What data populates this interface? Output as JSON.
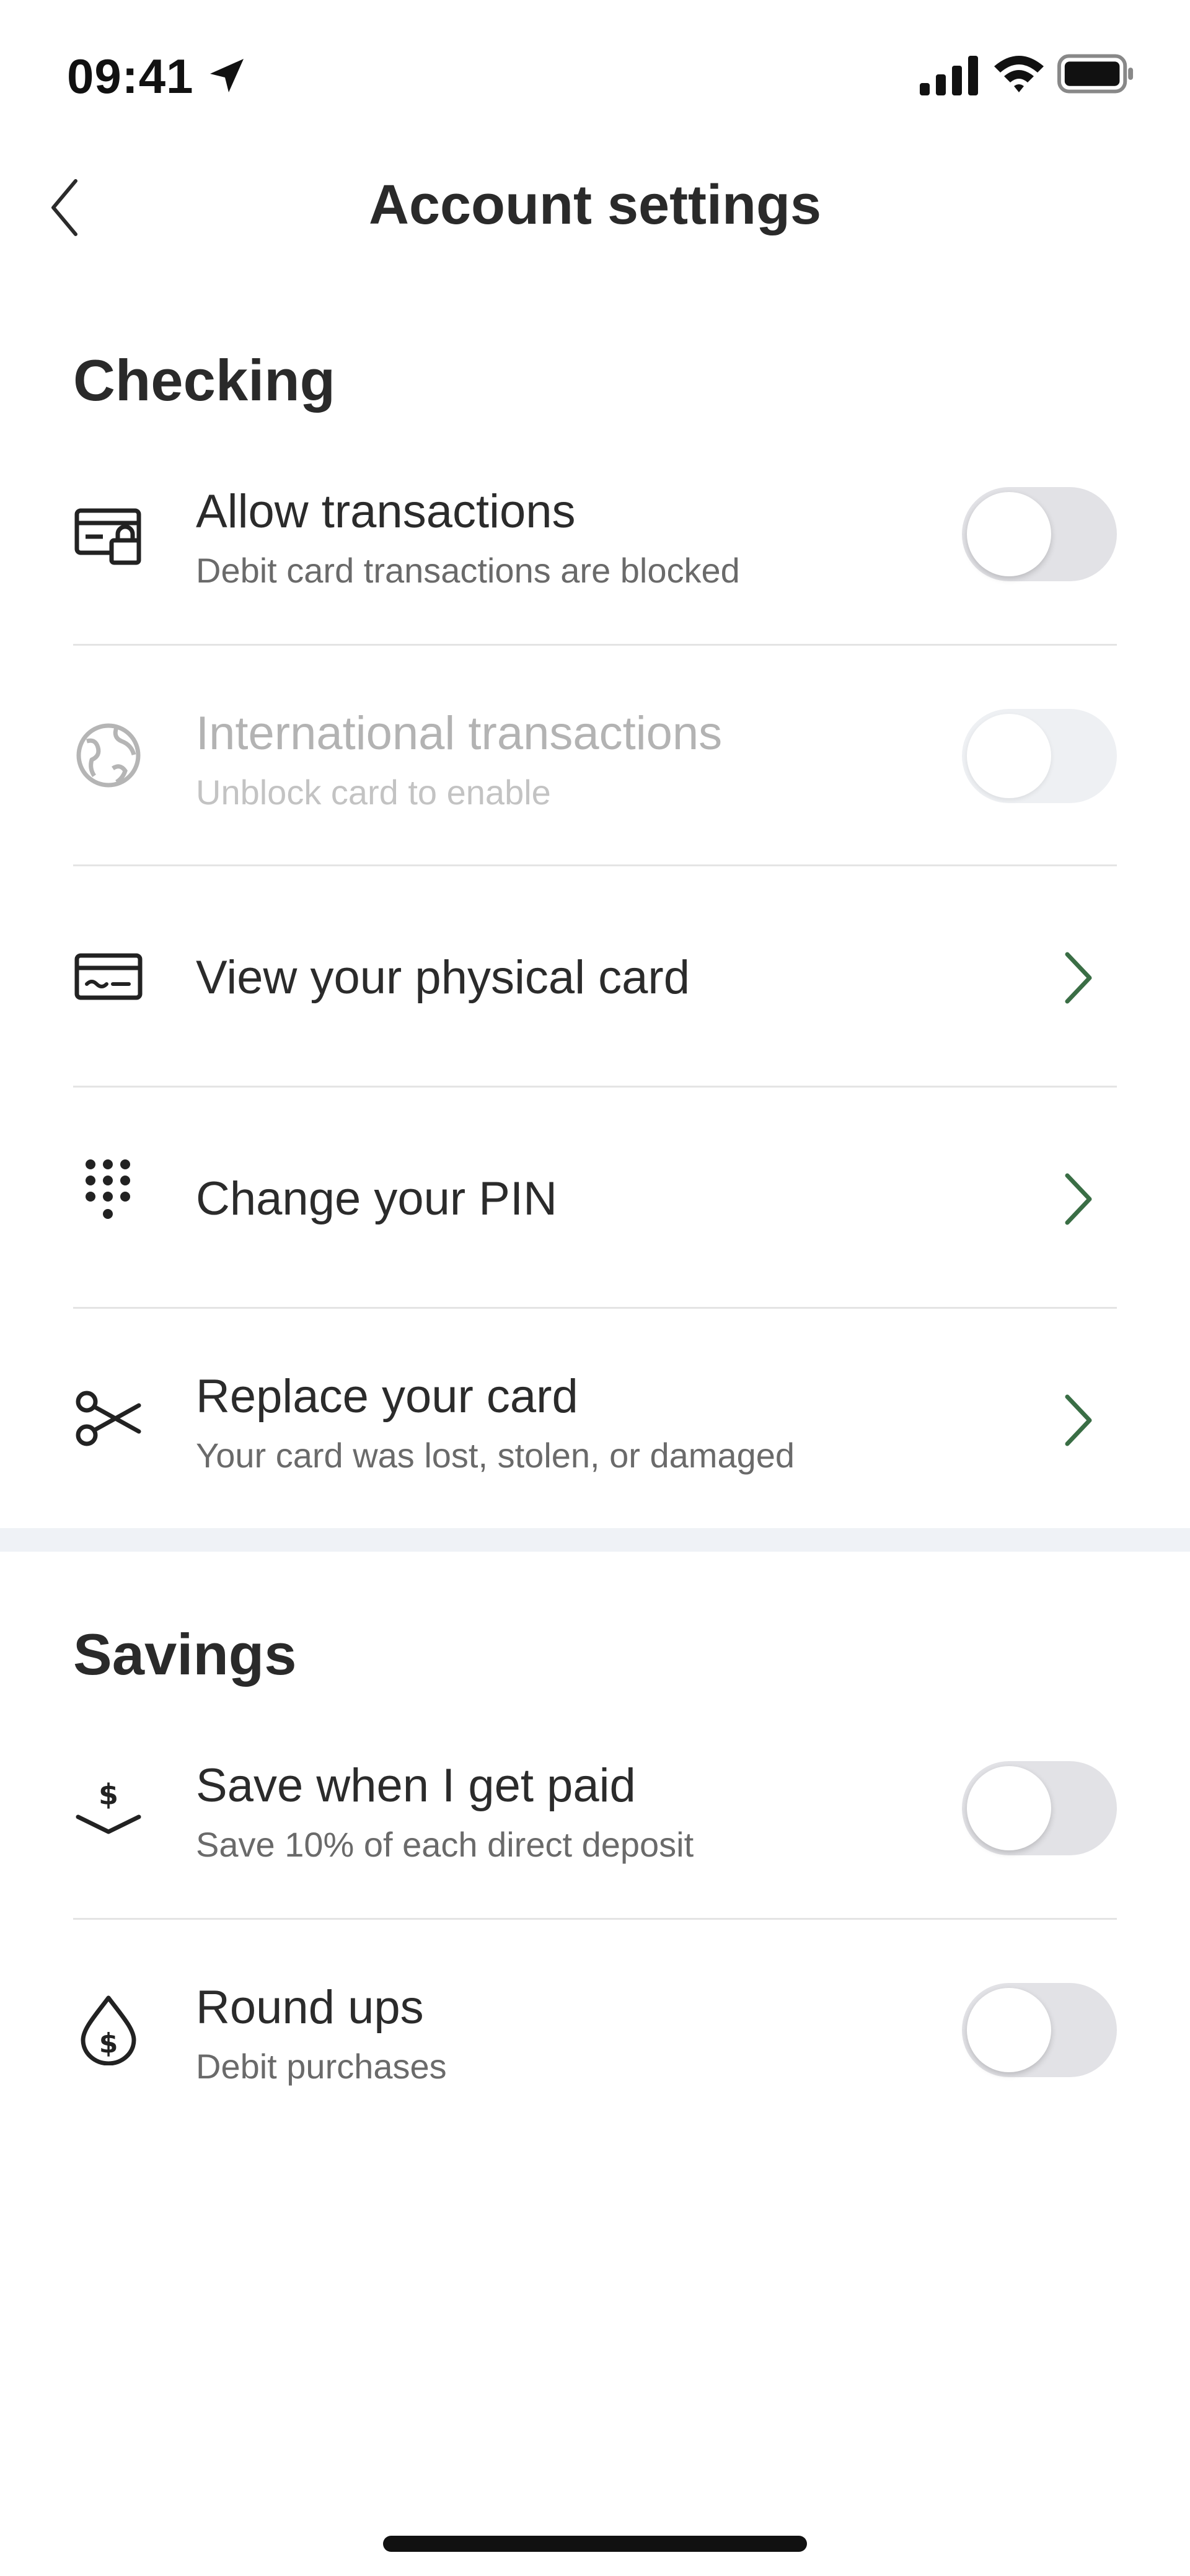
{
  "status_bar": {
    "time": "09:41",
    "icons": [
      "location-arrow-icon",
      "cellular-signal-icon",
      "wifi-icon",
      "battery-icon"
    ]
  },
  "nav": {
    "title": "Account settings",
    "back_icon": "chevron-left-icon"
  },
  "checking": {
    "title": "Checking",
    "items": [
      {
        "title": "Allow transactions",
        "subtitle": "Debit card transactions are blocked",
        "icon": "card-lock-icon",
        "control": "toggle",
        "on": false,
        "disabled": false
      },
      {
        "title": "International transactions",
        "subtitle": "Unblock card to enable",
        "icon": "globe-icon",
        "control": "toggle",
        "on": false,
        "disabled": true
      },
      {
        "title": "View your physical card",
        "icon": "card-icon",
        "control": "chevron"
      },
      {
        "title": "Change your PIN",
        "icon": "keypad-icon",
        "control": "chevron"
      },
      {
        "title": "Replace your card",
        "subtitle": "Your card was lost, stolen, or damaged",
        "icon": "scissors-icon",
        "control": "chevron"
      }
    ]
  },
  "savings": {
    "title": "Savings",
    "items": [
      {
        "title": "Save when I get paid",
        "subtitle": "Save 10% of each direct deposit",
        "icon": "dollar-tray-icon",
        "control": "toggle",
        "on": false,
        "disabled": false
      },
      {
        "title": "Round ups",
        "subtitle": "Debit purchases",
        "icon": "dollar-drop-icon",
        "control": "toggle",
        "on": false,
        "disabled": false
      }
    ]
  },
  "colors": {
    "text": "#2b2b2b",
    "subtitle": "#6a6a6a",
    "disabled_text": "#b3b3b3",
    "chevron_accent": "#3a6e45",
    "toggle_off": "#e2e2e6",
    "section_band": "#eff2f6"
  }
}
